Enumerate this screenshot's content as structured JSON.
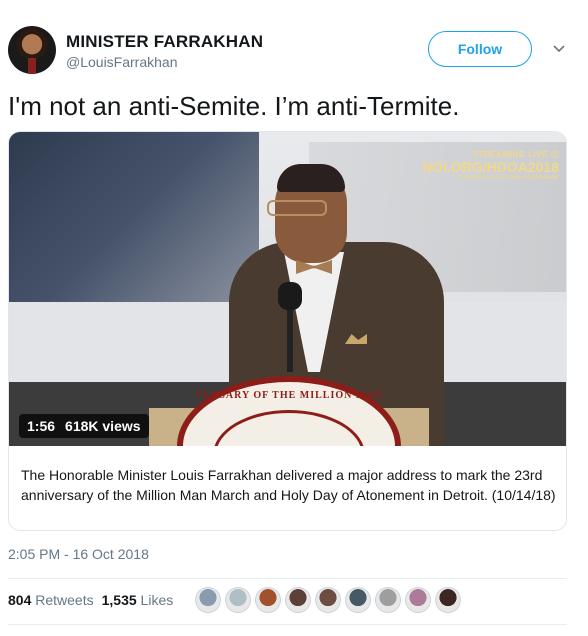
{
  "user": {
    "name": "MINISTER FARRAKHAN",
    "handle": "@LouisFarrakhan",
    "follow_label": "Follow"
  },
  "tweet": {
    "text": "I'm not an anti-Semite. I’m anti-Termite.",
    "timestamp": "2:05 PM - 16 Oct 2018"
  },
  "video": {
    "duration": "1:56",
    "views": "618K views",
    "stream_line1": "STREAMING LIVE @",
    "stream_line2": "NOI.ORG/HDOA2018",
    "stream_line3": "Detroit | Aretha Franklin Amphitheater",
    "seal_text": "VERSARY OF THE MILLION MAN",
    "caption": "The Honorable Minister Louis Farrakhan delivered a major address to mark the 23rd anniversary of the Million Man March and Holy Day of Atonement in Detroit. (10/14/18)"
  },
  "stats": {
    "retweets_count": "804",
    "retweets_label": "Retweets",
    "likes_count": "1,535",
    "likes_label": "Likes"
  },
  "liker_avatars": [
    "#8a9bb0",
    "#b0bec5",
    "#a0522d",
    "#5d4037",
    "#6d4c41",
    "#455a64",
    "#9e9e9e",
    "#ad7a99",
    "#3e2723"
  ],
  "colors": {
    "accent": "#1da1f2",
    "secondary_text": "#657786"
  }
}
